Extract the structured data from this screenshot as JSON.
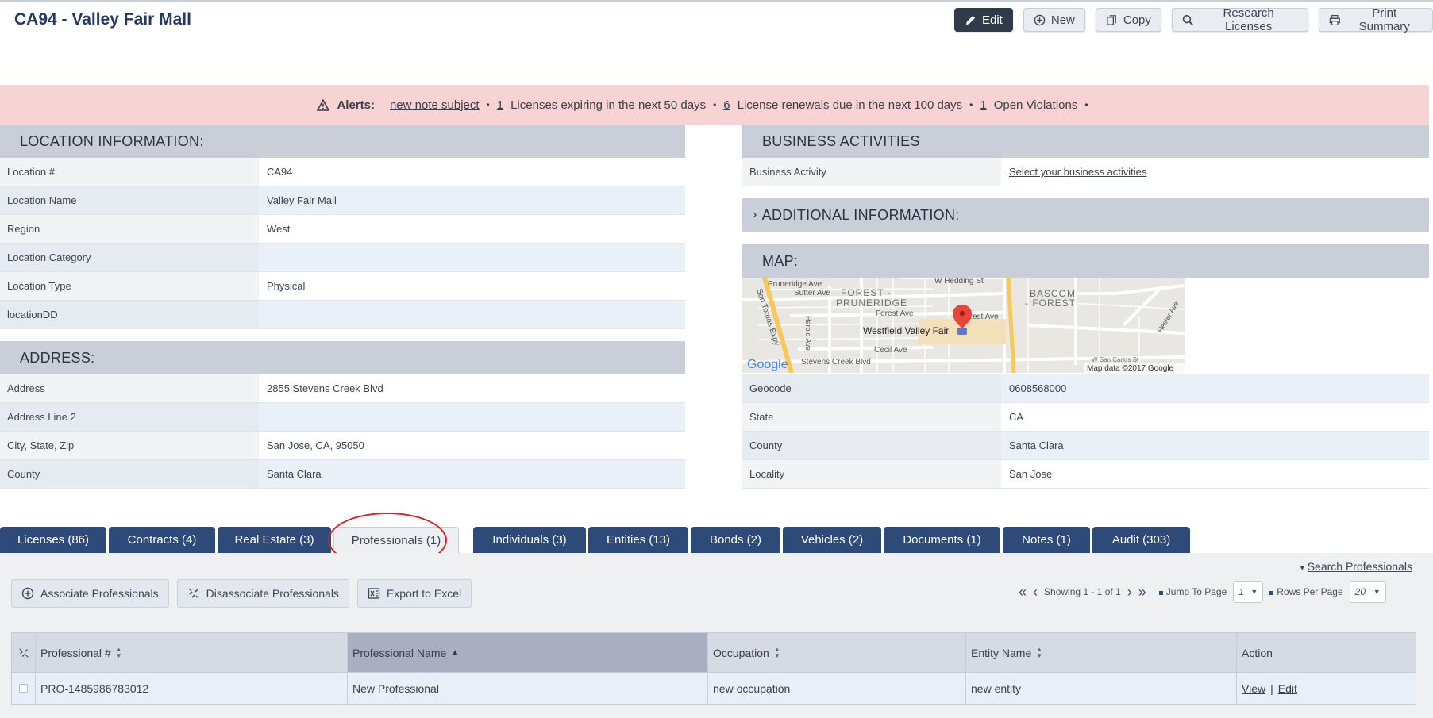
{
  "page": {
    "title": "CA94 - Valley Fair Mall"
  },
  "toolbar": {
    "edit": "Edit",
    "new": "New",
    "copy": "Copy",
    "research": "Research Licenses",
    "print": "Print Summary"
  },
  "alerts": {
    "label": "Alerts:",
    "note_subject": "new note subject",
    "expiring_count": "1",
    "expiring_text": "Licenses expiring in the next 50 days",
    "renewals_count": "6",
    "renewals_text": "License renewals due in the next 100 days",
    "violations_count": "1",
    "violations_text": "Open Violations"
  },
  "location": {
    "heading": "LOCATION INFORMATION:",
    "rows": [
      {
        "key": "Location #",
        "value": "CA94"
      },
      {
        "key": "Location Name",
        "value": "Valley Fair Mall"
      },
      {
        "key": "Region",
        "value": "West"
      },
      {
        "key": "Location Category",
        "value": ""
      },
      {
        "key": "Location Type",
        "value": "Physical"
      },
      {
        "key": "locationDD",
        "value": ""
      }
    ]
  },
  "address": {
    "heading": "ADDRESS:",
    "rows": [
      {
        "key": "Address",
        "value": "2855 Stevens Creek Blvd"
      },
      {
        "key": "Address Line 2",
        "value": ""
      },
      {
        "key": "City, State, Zip",
        "value": "San Jose, CA, 95050"
      },
      {
        "key": "County",
        "value": "Santa Clara"
      }
    ]
  },
  "business": {
    "heading": "BUSINESS ACTIVITIES",
    "key": "Business Activity",
    "value": "Select your business activities"
  },
  "additional": {
    "heading": "ADDITIONAL INFORMATION:",
    "chevron": "›"
  },
  "map": {
    "heading": "MAP:",
    "labels": {
      "hedding": "W Hedding St",
      "pruneridge": "Pruneridge Ave",
      "sutter": "Sutter Ave",
      "forest_pruneridge_1": "FOREST -",
      "forest_pruneridge_2": "PRUNERIDGE",
      "forest_ave": "Forest Ave",
      "forest_ave2": "Forest Ave",
      "bascom_1": "BASCOM",
      "bascom_2": "- FOREST",
      "san_tomas": "San Tomas Expy",
      "harold": "Harold Ave",
      "westfield": "Westfield Valley Fair",
      "cecil": "Cecil Ave",
      "stevens": "Stevens Creek Blvd",
      "hester": "Hester Ave",
      "san_carlos": "W San Carlos St",
      "google": "Google",
      "attribution": "Map data ©2017 Google"
    },
    "rows": [
      {
        "key": "Geocode",
        "value": "0608568000"
      },
      {
        "key": "State",
        "value": "CA"
      },
      {
        "key": "County",
        "value": "Santa Clara"
      },
      {
        "key": "Locality",
        "value": "San Jose"
      }
    ]
  },
  "tabs": [
    {
      "label": "Licenses (86)"
    },
    {
      "label": "Contracts (4)"
    },
    {
      "label": "Real Estate (3)"
    },
    {
      "label": "Professionals (1)"
    },
    {
      "label": "Individuals (3)"
    },
    {
      "label": "Entities (13)"
    },
    {
      "label": "Bonds (2)"
    },
    {
      "label": "Vehicles (2)"
    },
    {
      "label": "Documents (1)"
    },
    {
      "label": "Notes (1)"
    },
    {
      "label": "Audit (303)"
    }
  ],
  "professionals": {
    "search_link": "Search Professionals",
    "associate": "Associate Professionals",
    "disassociate": "Disassociate Professionals",
    "export": "Export to Excel",
    "showing": "Showing 1 - 1 of 1",
    "jump_label": "Jump To Page",
    "jump_value": "1",
    "rows_label": "Rows Per Page",
    "rows_value": "20",
    "columns": {
      "number": "Professional #",
      "name": "Professional Name",
      "occupation": "Occupation",
      "entity": "Entity Name",
      "action": "Action"
    },
    "row": {
      "number": "PRO-1485986783012",
      "name": "New Professional",
      "occupation": "new occupation",
      "entity": "new entity",
      "view": "View",
      "sep": "|",
      "edit": "Edit"
    }
  },
  "colors": {
    "alert_bg": "#f8d3d3",
    "section_bg": "#c9ced8",
    "tab_bg": "#2e4a78",
    "primary_btn": "#2f3a4b",
    "highlight_circle": "#d8232a"
  }
}
